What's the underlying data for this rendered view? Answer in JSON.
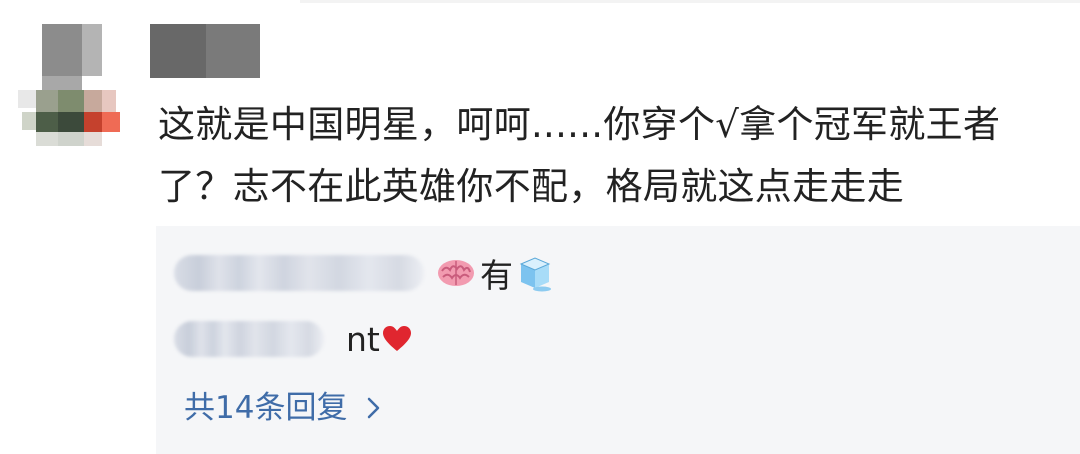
{
  "comment": {
    "text": "这就是中国明星，呵呵......你穿个√拿个冠军就王者了？志不在此英雄你不配，格局就这点走走走"
  },
  "replies": [
    {
      "text": "有",
      "emoji_before": "brain-emoji",
      "emoji_after": "ice-cube-emoji"
    },
    {
      "text": "nt",
      "emoji_after": "red-heart-emoji"
    }
  ],
  "more_replies": {
    "label": "共14条回复"
  },
  "colors": {
    "text": "#222222",
    "link": "#3f6ca8",
    "reply_bg": "#f5f6f8",
    "heart": "#e0262f"
  }
}
